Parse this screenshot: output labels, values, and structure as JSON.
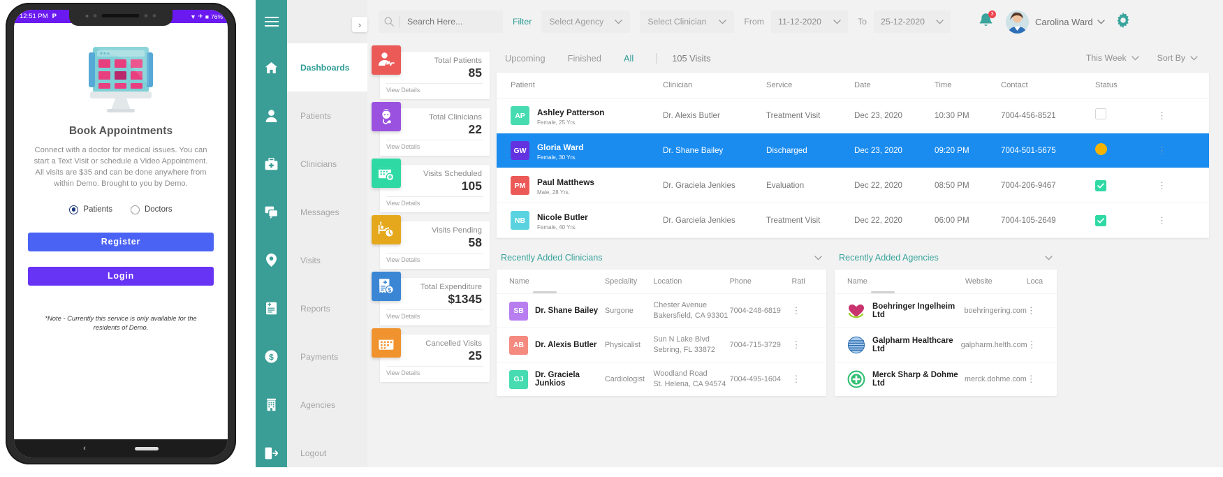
{
  "phone": {
    "status_time": "12:51 PM",
    "status_p": "P",
    "battery": "76%",
    "app_title": "Book Appointments",
    "app_desc": "Connect with a doctor for medical issues. You can start a Text Visit or schedule a Video Appointment. All visits are $35 and can be done anywhere from within Demo. Brought to you by Demo.",
    "role_patients": "Patients",
    "role_doctors": "Doctors",
    "btn_register": "Register",
    "btn_login": "Login",
    "note": "*Note - Currently this service is only available for the residents of Demo."
  },
  "sidebar": {
    "items": [
      {
        "label": "Dashboards",
        "icon": "home-icon",
        "active": true
      },
      {
        "label": "Patients",
        "icon": "user-icon",
        "active": false
      },
      {
        "label": "Clinicians",
        "icon": "medkit-icon",
        "active": false
      },
      {
        "label": "Messages",
        "icon": "chat-icon",
        "active": false
      },
      {
        "label": "Visits",
        "icon": "location-pin-icon",
        "active": false
      },
      {
        "label": "Reports",
        "icon": "document-icon",
        "active": false
      },
      {
        "label": "Payments",
        "icon": "dollar-icon",
        "active": false
      },
      {
        "label": "Agencies",
        "icon": "building-icon",
        "active": false
      },
      {
        "label": "Logout",
        "icon": "logout-icon",
        "active": false
      }
    ]
  },
  "topbar": {
    "search_placeholder": "Search Here...",
    "filter_label": "Filter",
    "select_agency": "Select Agency",
    "select_clinician": "Select Clinician",
    "from_label": "From",
    "from_date": "11-12-2020",
    "to_label": "To",
    "to_date": "25-12-2020",
    "notification_count": "3",
    "user_name": "Carolina Ward"
  },
  "stat_cards": [
    {
      "label": "Total Patients",
      "value": "85",
      "foot": "View Details",
      "color": "#ec5a58",
      "icon": "patient-icon"
    },
    {
      "label": "Total Clinicians",
      "value": "22",
      "foot": "View Details",
      "color": "#9b51e0",
      "icon": "clinician-icon"
    },
    {
      "label": "Visits Scheduled",
      "value": "105",
      "foot": "View Details",
      "color": "#2fd9a4",
      "icon": "calendar-plus-icon"
    },
    {
      "label": "Visits Pending",
      "value": "58",
      "foot": "View Details",
      "color": "#e5a81d",
      "icon": "bed-clock-icon"
    },
    {
      "label": "Total Expenditure",
      "value": "$1345",
      "foot": "View Details",
      "color": "#3b86d4",
      "icon": "invoice-icon"
    },
    {
      "label": "Cancelled Visits",
      "value": "25",
      "foot": "View Details",
      "color": "#f0922e",
      "icon": "calendar-icon"
    }
  ],
  "visits": {
    "tabs": [
      {
        "label": "Upcoming",
        "active": false
      },
      {
        "label": "Finished",
        "active": false
      },
      {
        "label": "All",
        "active": true
      }
    ],
    "count_label": "105 Visits",
    "week_filter": "This Week",
    "sort_label": "Sort By",
    "columns": [
      "Patient",
      "Clinician",
      "Service",
      "Date",
      "Time",
      "Contact",
      "Status"
    ],
    "rows": [
      {
        "initials": "AP",
        "avatar_color": "#46dbb0",
        "name": "Ashley Patterson",
        "sub": "Female, 25 Yrs.",
        "clinician": "Dr. Alexis Butler",
        "service": "Treatment Visit",
        "date": "Dec 23, 2020",
        "time": "10:30 PM",
        "contact": "7004-456-8521",
        "status": "unchecked",
        "selected": false
      },
      {
        "initials": "GW",
        "avatar_color": "#6433e0",
        "name": "Gloria Ward",
        "sub": "Female, 30 Yrs.",
        "clinician": "Dr. Shane Bailey",
        "service": "Discharged",
        "date": "Dec 23, 2020",
        "time": "09:20 PM",
        "contact": "7004-501-5675",
        "status": "amber",
        "selected": true
      },
      {
        "initials": "PM",
        "avatar_color": "#ec5a58",
        "name": "Paul Matthews",
        "sub": "Male, 28 Yrs.",
        "clinician": "Dr. Graciela Jenkies",
        "service": "Evaluation",
        "date": "Dec 22, 2020",
        "time": "08:50 PM",
        "contact": "7004-206-9467",
        "status": "green",
        "selected": false
      },
      {
        "initials": "NB",
        "avatar_color": "#5ad3e0",
        "name": "Nicole Butler",
        "sub": "Female, 40 Yrs.",
        "clinician": "Dr. Garciela Jenkies",
        "service": "Treatment Visit",
        "date": "Dec 22, 2020",
        "time": "06:00 PM",
        "contact": "7004-105-2649",
        "status": "green",
        "selected": false
      }
    ]
  },
  "clinicians_panel": {
    "title": "Recently Added Clinicians",
    "columns": [
      "Name",
      "Speciality",
      "Location",
      "Phone",
      "Rati"
    ],
    "rows": [
      {
        "initials": "SB",
        "avatar_color": "#b87ef0",
        "name": "Dr. Shane Bailey",
        "speciality": "Surgone",
        "location_line1": "Chester Avenue",
        "location_line2": "Bakersfield, CA 93301",
        "phone": "7004-248-6819"
      },
      {
        "initials": "AB",
        "avatar_color": "#f48a80",
        "name": "Dr. Alexis Butler",
        "speciality": "Physicalist",
        "location_line1": "Sun N Lake Blvd",
        "location_line2": "Sebring, FL 33872",
        "phone": "7004-715-3729"
      },
      {
        "initials": "GJ",
        "avatar_color": "#46dbb0",
        "name": "Dr. Graciela Junkios",
        "speciality": "Cardiologist",
        "location_line1": "Woodland Road",
        "location_line2": "St. Helena, CA 94574",
        "phone": "7004-495-1604"
      }
    ]
  },
  "agencies_panel": {
    "title": "Recently Added Agencies",
    "columns": [
      "Name",
      "Website",
      "Loca"
    ],
    "rows": [
      {
        "logo": "heart-logo",
        "logo_color": "#c9336e",
        "name": "Boehringer Ingelheim Ltd",
        "website": "boehringering.com"
      },
      {
        "logo": "globe-logo",
        "logo_color": "#4a90d9",
        "name": "Galpharm Healthcare Ltd",
        "website": "galpharm.helth.com"
      },
      {
        "logo": "cross-logo",
        "logo_color": "#2fbf71",
        "name": "Merck Sharp & Dohme Ltd",
        "website": "merck.dohme.com"
      }
    ]
  }
}
